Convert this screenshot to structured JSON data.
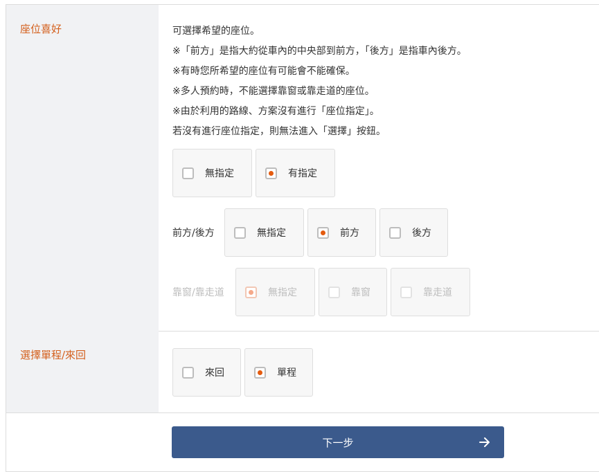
{
  "seat_preference": {
    "label": "座位喜好",
    "description": [
      "可選擇希望的座位。",
      "※「前方」是指大約從車內的中央部到前方，「後方」是指車內後方。",
      "※有時您所希望的座位有可能會不能確保。",
      "※多人預約時，不能選擇靠窗或靠走道的座位。",
      "※由於利用的路線、方案沒有進行「座位指定」。",
      "若沒有進行座位指定，則無法進入「選擇」按鈕。"
    ],
    "designation": {
      "options": [
        {
          "label": "無指定",
          "checked": false
        },
        {
          "label": "有指定",
          "checked": true
        }
      ]
    },
    "front_back": {
      "label": "前方/後方",
      "options": [
        {
          "label": "無指定",
          "checked": false
        },
        {
          "label": "前方",
          "checked": true
        },
        {
          "label": "後方",
          "checked": false
        }
      ]
    },
    "window_aisle": {
      "label": "靠窗/靠走道",
      "disabled": true,
      "options": [
        {
          "label": "無指定",
          "checked": true
        },
        {
          "label": "靠窗",
          "checked": false
        },
        {
          "label": "靠走道",
          "checked": false
        }
      ]
    }
  },
  "trip_type": {
    "label": "選擇單程/來回",
    "options": [
      {
        "label": "來回",
        "checked": false
      },
      {
        "label": "單程",
        "checked": true
      }
    ]
  },
  "next_button": {
    "label": "下一步",
    "icon": "arrow-right-icon"
  },
  "colors": {
    "accent": "#d4601d",
    "radio_dot": "#e45b0f",
    "button": "#3b5a8c",
    "label_bg": "#f1f2f4"
  }
}
